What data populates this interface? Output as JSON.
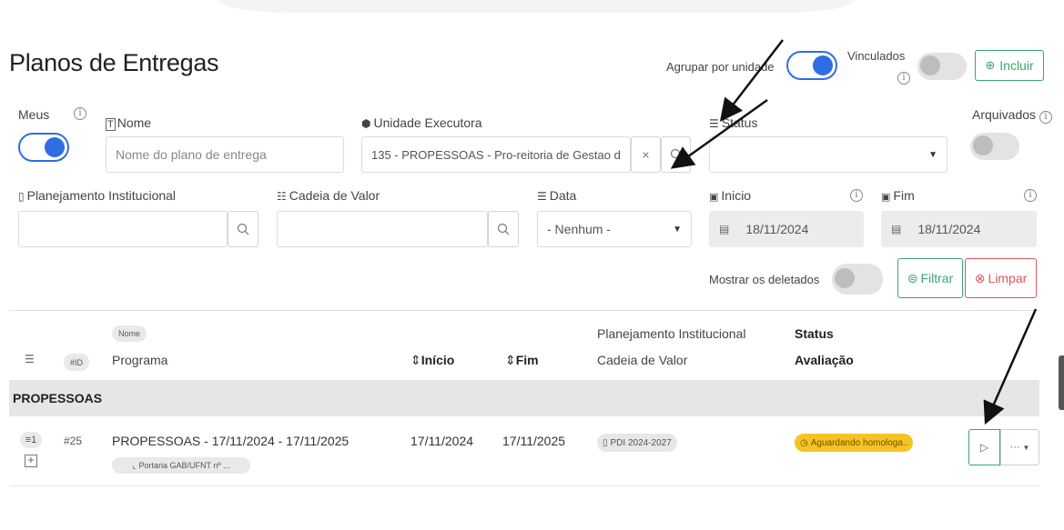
{
  "header": {
    "title": "Planos de Entregas",
    "agrupar_label": "Agrupar por unidade",
    "vinculados_label": "Vinculados",
    "incluir_label": "Incluir"
  },
  "filters": {
    "meus_label": "Meus",
    "nome_label": "Nome",
    "nome_placeholder": "Nome do plano de entrega",
    "unidade_label": "Unidade Executora",
    "unidade_value": "135 - PROPESSOAS - Pro-reitoria de Gestao d",
    "status_label": "Status",
    "arquivados_label": "Arquivados",
    "planejamento_label": "Planejamento Institucional",
    "cadeia_label": "Cadeia de Valor",
    "data_label": "Data",
    "data_value": "- Nenhum -",
    "inicio_label": "Inicio",
    "inicio_value": "18/11/2024",
    "fim_label": "Fim",
    "fim_value": "18/11/2024",
    "mostrar_deletados_label": "Mostrar os deletados",
    "filtrar_label": "Filtrar",
    "limpar_label": "Limpar"
  },
  "table": {
    "headers": {
      "id": "#ID",
      "nome_pill": "Nome",
      "programa": "Programa",
      "inicio": "Início",
      "fim": "Fim",
      "planejamento": "Planejamento Institucional",
      "cadeia": "Cadeia de Valor",
      "status": "Status",
      "avaliacao": "Avaliação"
    },
    "group": "PROPESSOAS",
    "rows": [
      {
        "count": "1",
        "id": "#25",
        "nome": "PROPESSOAS - 17/11/2024 - 17/11/2025",
        "programa_pill": "Portaria GAB/UFNT nº ...",
        "inicio": "17/11/2024",
        "fim": "17/11/2025",
        "planejamento": "PDI 2024-2027",
        "status": "Aguardando homologa..",
        "more": "···"
      }
    ]
  },
  "colors": {
    "accent": "#2f6de3",
    "success": "#3aa76d",
    "danger": "#e0555b",
    "warning": "#f6c324",
    "group_bg": "#e6e6e6"
  }
}
